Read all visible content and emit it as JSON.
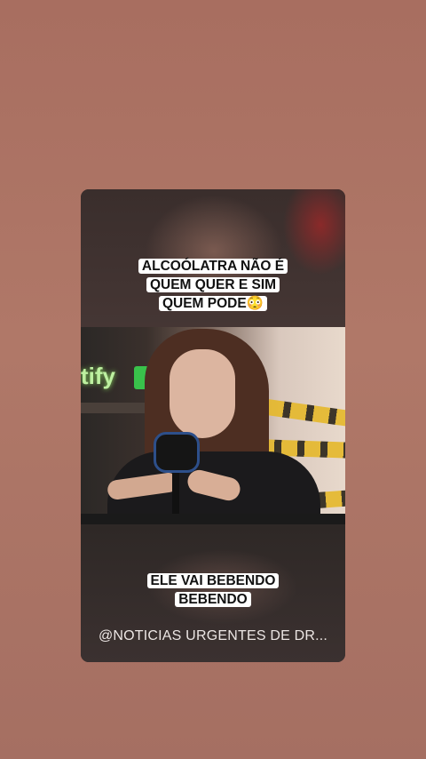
{
  "story": {
    "caption_top_lines": [
      "ALCOÓLATRA NÃO É",
      "QUEM QUER E SIM",
      "QUEM PODE😳"
    ],
    "caption_bottom_lines": [
      "ELE VAI BEBENDO",
      "BEBENDO"
    ],
    "watermark": "@NOTICIAS URGENTES DE DR..."
  },
  "colors": {
    "background": "#a86e60",
    "caption_bg": "#ffffff",
    "caption_text": "#111111",
    "mic_accent": "#2d4f8a"
  },
  "icons": [
    "microphone-icon"
  ]
}
